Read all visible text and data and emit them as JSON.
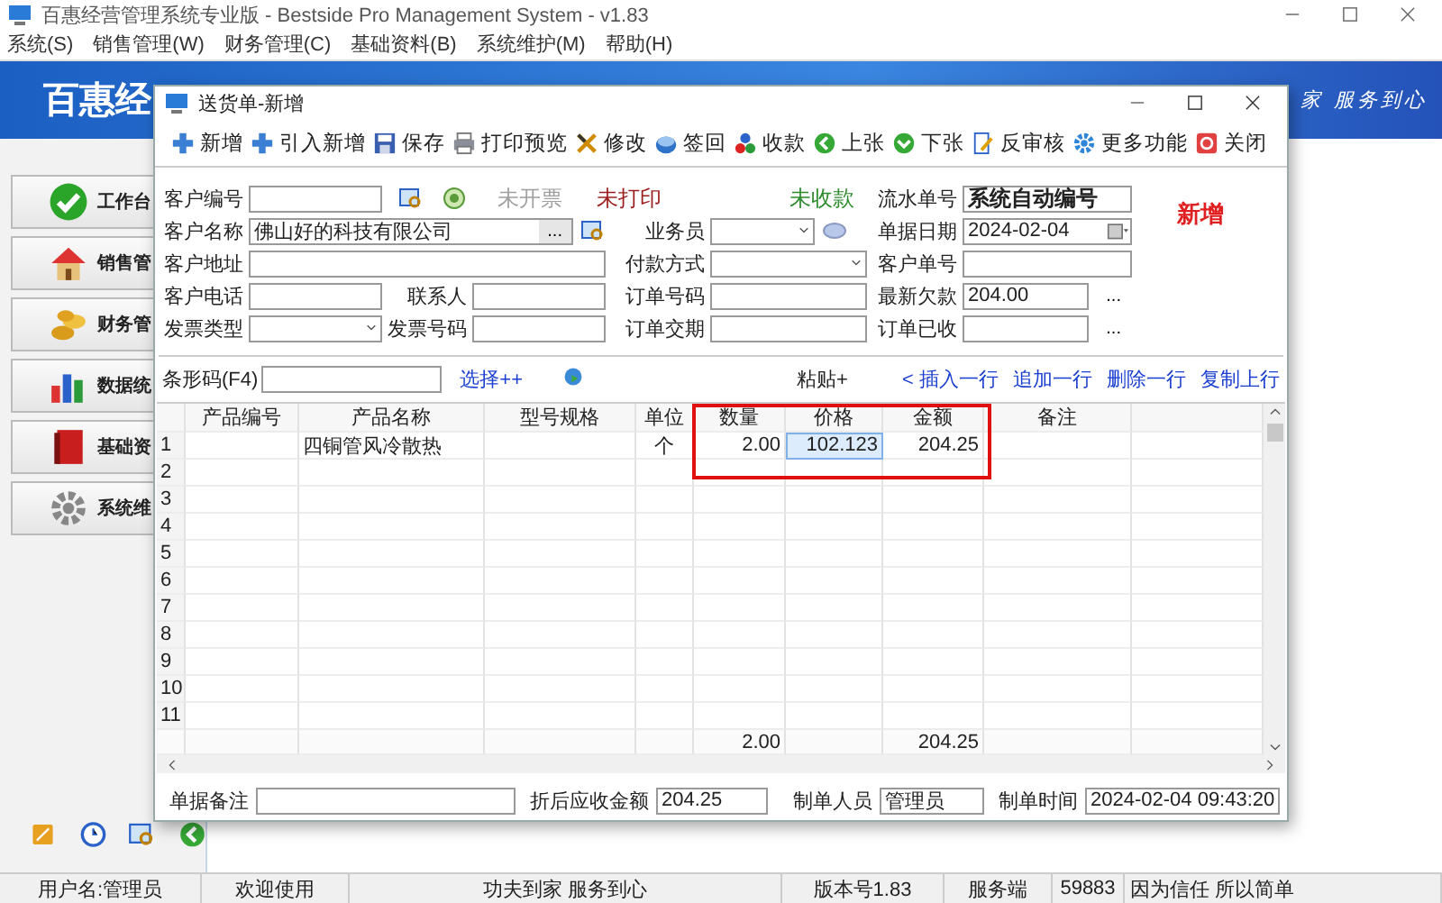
{
  "window": {
    "title": "百惠经营管理系统专业版 - Bestside Pro Management System - v1.83"
  },
  "menu": [
    "系统(S)",
    "销售管理(W)",
    "财务管理(C)",
    "基础资料(B)",
    "系统维护(M)",
    "帮助(H)"
  ],
  "banner": {
    "title": "百惠经",
    "slogan": "家 服务到心"
  },
  "sidebar": {
    "items": [
      "工作台",
      "销售管",
      "财务管",
      "数据统",
      "基础资",
      "系统维"
    ]
  },
  "dialog": {
    "title": "送货单-新增",
    "toolbar": [
      "新增",
      "引入新增",
      "保存",
      "打印预览",
      "修改",
      "签回",
      "收款",
      "上张",
      "下张",
      "反审核",
      "更多功能",
      "关闭"
    ],
    "statuses": [
      {
        "text": "未开票",
        "color": "#a0a0a0"
      },
      {
        "text": "未打印",
        "color": "#9b1c1c"
      },
      {
        "text": "未收款",
        "color": "#2e8b2e"
      }
    ],
    "mode": "新增",
    "fields": [
      {
        "label": "客户编号",
        "kind": "text"
      },
      {
        "label": "流水单号",
        "kind": "text",
        "value": "系统自动编号",
        "emphasis": true
      },
      {
        "label": "客户名称",
        "kind": "lookup",
        "value": "佛山好的科技有限公司",
        "button": "..."
      },
      {
        "label": "业务员",
        "kind": "select"
      },
      {
        "label": "单据日期",
        "kind": "date",
        "value": "2024-02-04"
      },
      {
        "label": "客户地址",
        "kind": "text"
      },
      {
        "label": "付款方式",
        "kind": "select"
      },
      {
        "label": "客户单号",
        "kind": "text"
      },
      {
        "label": "客户电话",
        "kind": "text"
      },
      {
        "label": "联系人",
        "kind": "text"
      },
      {
        "label": "订单号码",
        "kind": "text"
      },
      {
        "label": "最新欠款",
        "kind": "text",
        "value": "204.00",
        "button": "..."
      },
      {
        "label": "发票类型",
        "kind": "select"
      },
      {
        "label": "发票号码",
        "kind": "text"
      },
      {
        "label": "订单交期",
        "kind": "text"
      },
      {
        "label": "订单已收",
        "kind": "text",
        "button": "..."
      }
    ],
    "barcode": {
      "label": "条形码(F4)",
      "select_link": "选择++",
      "paste": "粘贴+",
      "row_actions": [
        "< 插入一行",
        "追加一行",
        "删除一行",
        "复制上行"
      ]
    },
    "table": {
      "columns": [
        "产品编号",
        "产品名称",
        "型号规格",
        "单位",
        "数量",
        "价格",
        "金额",
        "备注"
      ],
      "rows": [
        {
          "number": "1",
          "product_name": "四铜管风冷散热",
          "unit": "个",
          "quantity": "2.00",
          "price": {
            "text": "102.123",
            "selected": true
          },
          "amount": "204.25"
        },
        {
          "number": "2"
        },
        {
          "number": "3"
        },
        {
          "number": "4"
        },
        {
          "number": "5"
        },
        {
          "number": "6"
        },
        {
          "number": "7"
        },
        {
          "number": "8"
        },
        {
          "number": "9"
        },
        {
          "number": "10"
        },
        {
          "number": "11"
        }
      ],
      "totals": {
        "quantity": "2.00",
        "amount": "204.25"
      }
    },
    "footer": [
      {
        "label": "单据备注"
      },
      {
        "label": "折后应收金额",
        "value": "204.25"
      },
      {
        "label": "制单人员",
        "value": "管理员"
      },
      {
        "label": "制单时间",
        "value": "2024-02-04 09:43:20"
      }
    ]
  },
  "status_bar": [
    "用户名:管理员",
    "欢迎使用",
    "功夫到家 服务到心",
    "版本号1.83",
    "服务端",
    "59883",
    "因为信任 所以简单"
  ]
}
